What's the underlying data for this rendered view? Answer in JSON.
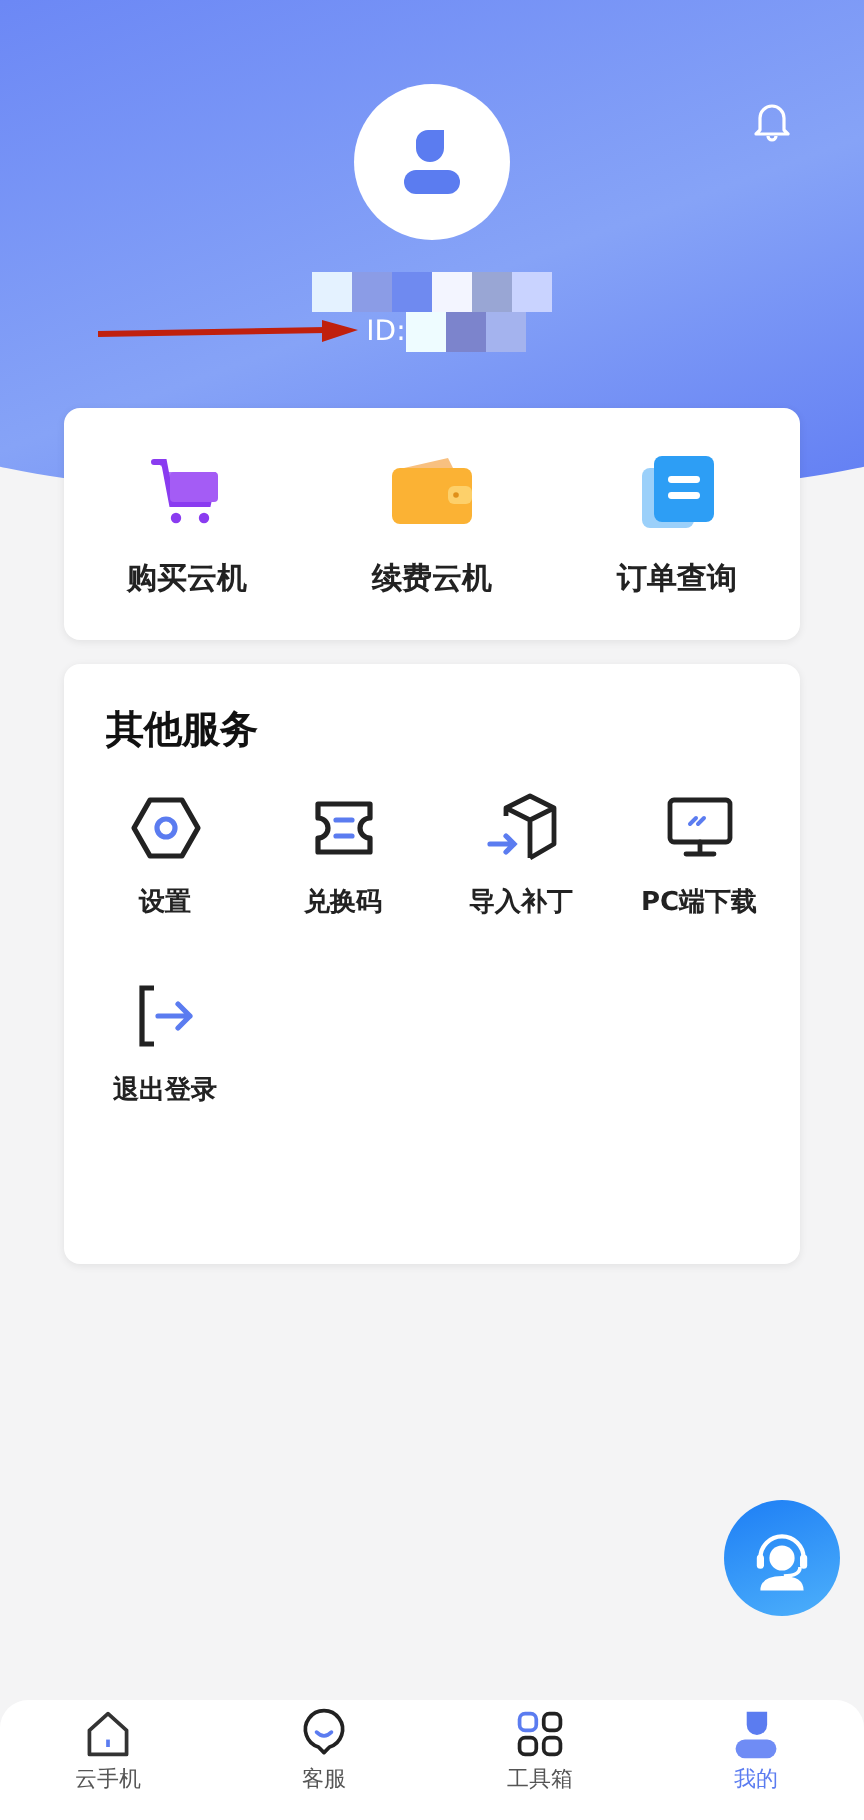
{
  "profile": {
    "id_label": "ID:"
  },
  "quick_actions": [
    {
      "label": "购买云机"
    },
    {
      "label": "续费云机"
    },
    {
      "label": "订单查询"
    }
  ],
  "other_services": {
    "title": "其他服务",
    "items": [
      {
        "label": "设置"
      },
      {
        "label": "兑换码"
      },
      {
        "label": "导入补丁"
      },
      {
        "label": "PC端下载"
      },
      {
        "label": "退出登录"
      }
    ]
  },
  "tab_bar": [
    {
      "label": "云手机",
      "selected": false
    },
    {
      "label": "客服",
      "selected": false
    },
    {
      "label": "工具箱",
      "selected": false
    },
    {
      "label": "我的",
      "selected": true
    }
  ]
}
